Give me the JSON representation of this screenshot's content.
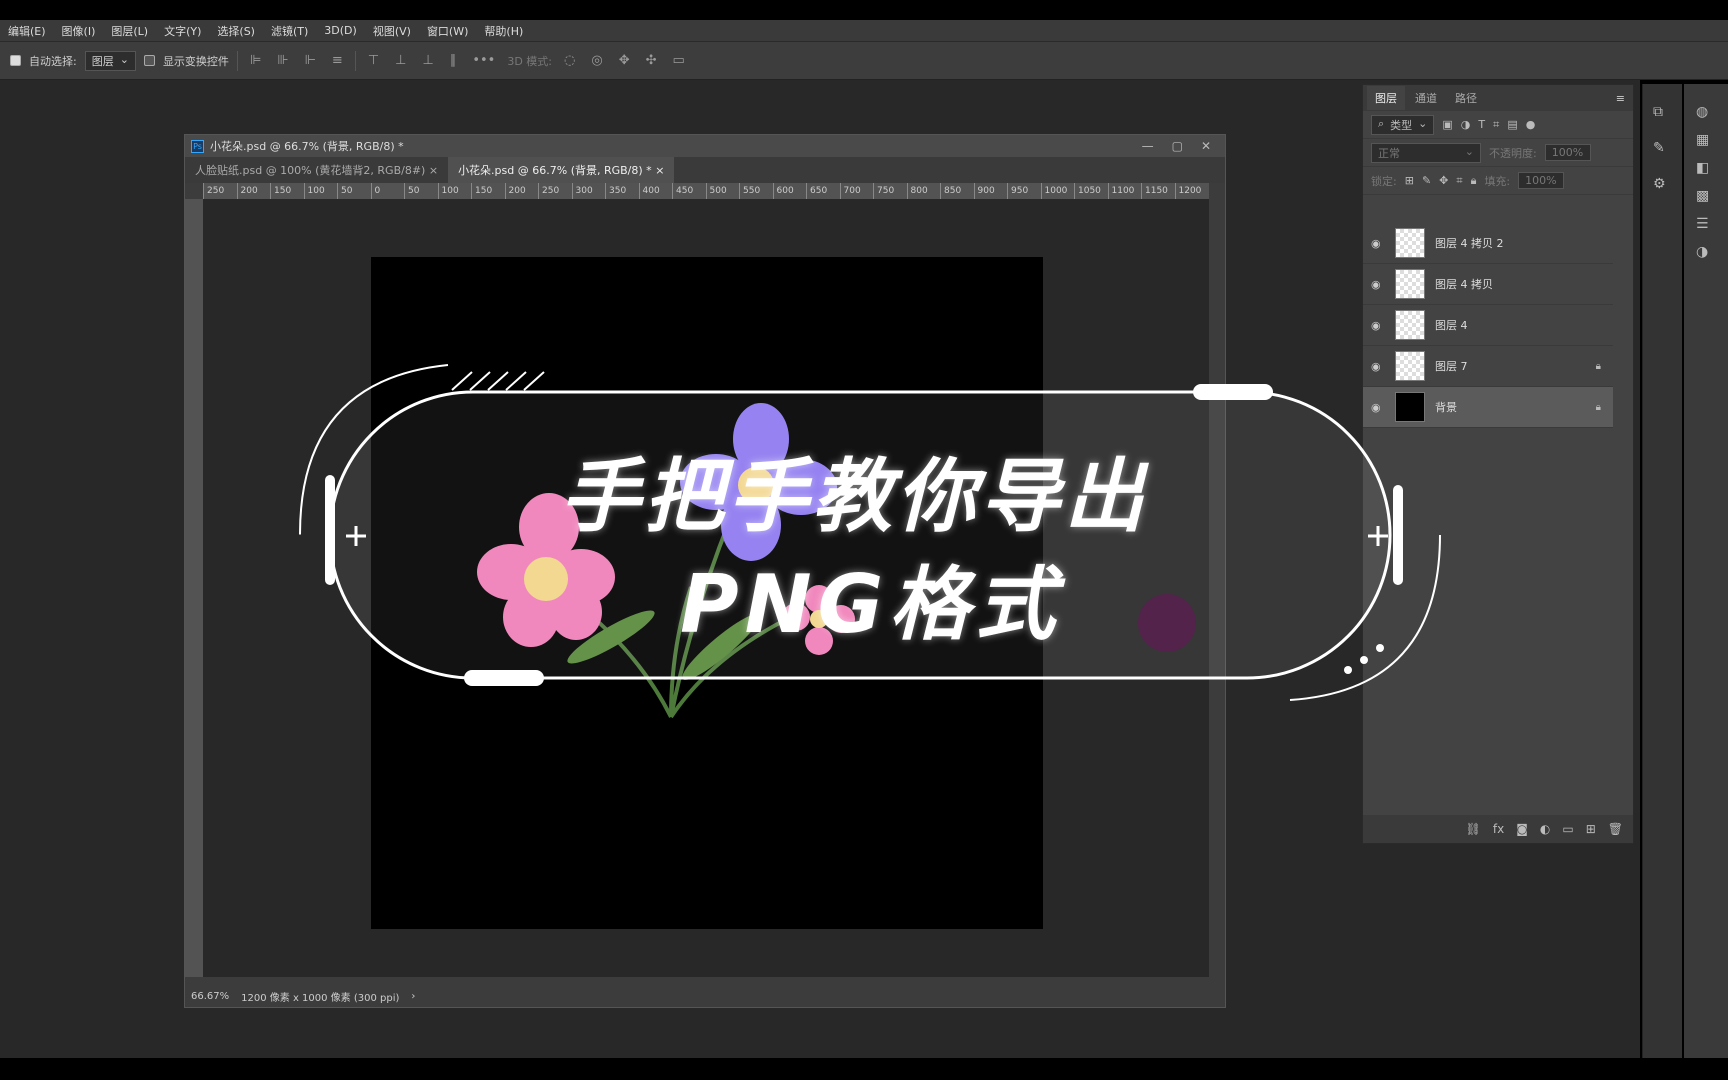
{
  "menu": [
    "编辑(E)",
    "图像(I)",
    "图层(L)",
    "文字(Y)",
    "选择(S)",
    "滤镜(T)",
    "3D(D)",
    "视图(V)",
    "窗口(W)",
    "帮助(H)"
  ],
  "options": {
    "auto_select": "自动选择:",
    "auto_select_value": "图层",
    "show_transform": "显示变换控件",
    "mode3d": "3D 模式:"
  },
  "document": {
    "window_title": "小花朵.psd @ 66.7% (背景, RGB/8) *",
    "tabs": [
      {
        "label": "人脸贴纸.psd @ 100% (黄花墙背2, RGB/8#)",
        "close": "×"
      },
      {
        "label": "小花朵.psd @ 66.7% (背景, RGB/8) *",
        "close": "×"
      }
    ],
    "ruler": [
      "250",
      "200",
      "150",
      "100",
      "50",
      "0",
      "50",
      "100",
      "150",
      "200",
      "250",
      "300",
      "350",
      "400",
      "450",
      "500",
      "550",
      "600",
      "650",
      "700",
      "750",
      "800",
      "850",
      "900",
      "950",
      "1000",
      "1050",
      "1100",
      "1150",
      "1200"
    ],
    "zoom": "66.67%",
    "size": "1200 像素 x 1000 像素 (300 ppi)"
  },
  "panel": {
    "tabs": [
      "图层",
      "通道",
      "路径"
    ],
    "filter": "类型",
    "blend": "正常",
    "opacity_label": "不透明度:",
    "opacity": "100%",
    "lock_label": "锁定:",
    "fill_label": "填充:",
    "fill": "100%",
    "layers": [
      {
        "name": "图层 4 拷贝 2",
        "locked": false
      },
      {
        "name": "图层 4 拷贝",
        "locked": false
      },
      {
        "name": "图层 4",
        "locked": false
      },
      {
        "name": "图层 7",
        "locked": true
      },
      {
        "name": "背景",
        "locked": true
      }
    ]
  },
  "overlay": {
    "line1": "手把手教你导出",
    "line2": "PNG格式"
  },
  "colors": {
    "accent": "#31a8ff",
    "bg": "#282828",
    "flower_pink": "#f07fb8",
    "flower_purple": "#8f7af0"
  }
}
